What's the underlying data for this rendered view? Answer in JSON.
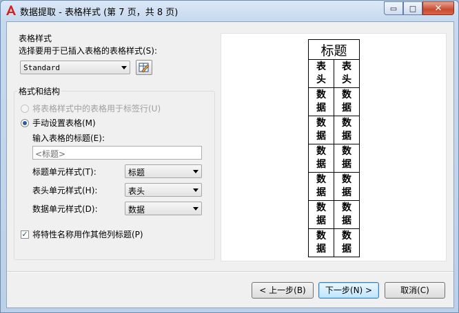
{
  "window": {
    "title": "数据提取 - 表格样式 (第 7 页，共 8 页)",
    "controls": {
      "minimize": "▭",
      "maximize": "□",
      "close": "✕"
    }
  },
  "table_style": {
    "group_title": "表格样式",
    "prompt": "选择要用于已插入表格的表格样式(S):",
    "selected": "Standard"
  },
  "format": {
    "group_title": "格式和结构",
    "option_use_style": "将表格样式中的表格用于标签行(U)",
    "option_manual": "手动设置表格(M)",
    "title_prompt": "输入表格的标题(E):",
    "title_placeholder": "<标题>",
    "title_cell_label": "标题单元样式(T):",
    "title_cell_value": "标题",
    "header_cell_label": "表头单元样式(H):",
    "header_cell_value": "表头",
    "data_cell_label": "数据单元样式(D):",
    "data_cell_value": "数据",
    "use_property_names": "将特性名称用作其他列标题(P)"
  },
  "preview": {
    "title": "标题",
    "headers": [
      "表\n头",
      "表\n头"
    ],
    "rows": [
      [
        "数\n据",
        "数\n据"
      ],
      [
        "数\n据",
        "数\n据"
      ],
      [
        "数\n据",
        "数\n据"
      ],
      [
        "数\n据",
        "数\n据"
      ],
      [
        "数\n据",
        "数\n据"
      ],
      [
        "数\n据",
        "数\n据"
      ]
    ]
  },
  "buttons": {
    "back": "< 上一步(B)",
    "next": "下一步(N) >",
    "cancel": "取消(C)"
  },
  "colors": {
    "accent": "#2c5aa0",
    "title_bar": "#c6d9ee"
  }
}
